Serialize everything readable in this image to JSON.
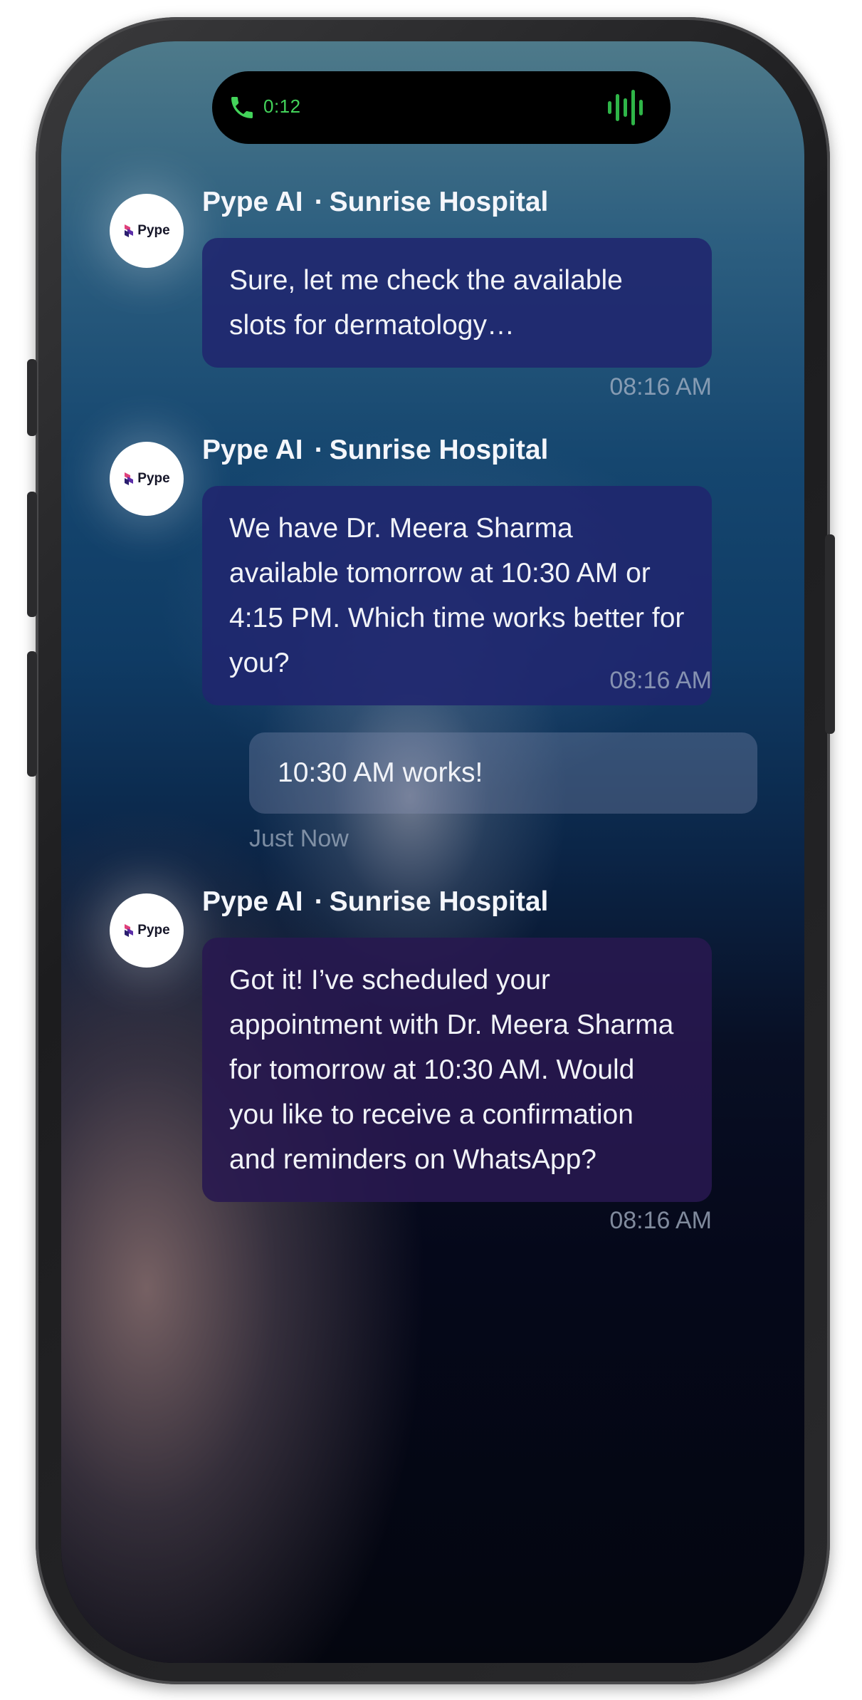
{
  "call_status": {
    "timer": "0:12",
    "accent_color": "#43d35a",
    "icons": [
      "phone-icon",
      "waveform-icon"
    ]
  },
  "messages": [
    {
      "sender": "Pype AI",
      "org": "Sunrise Hospital",
      "separator": "·",
      "avatar_logo": "Pype",
      "text": "Sure, let me check the available slots for dermatology…",
      "time": "08:16 AM"
    },
    {
      "sender": "Pype AI",
      "org": "Sunrise Hospital",
      "separator": "·",
      "avatar_logo": "Pype",
      "text": "We have Dr. Meera Sharma available tomorrow at 10:30 AM or 4:15 PM. Which time works better for you?",
      "time": "08:16 AM"
    },
    {
      "sender": "user",
      "text": "10:30 AM works!",
      "time": "Just Now"
    },
    {
      "sender": "Pype AI",
      "org": "Sunrise Hospital",
      "separator": "·",
      "avatar_logo": "Pype",
      "text": "Got it! I’ve scheduled your appointment with Dr. Meera Sharma for tomorrow at 10:30 AM. Would you like to receive a confirmation and reminders on WhatsApp?",
      "time": "08:16 AM"
    }
  ]
}
